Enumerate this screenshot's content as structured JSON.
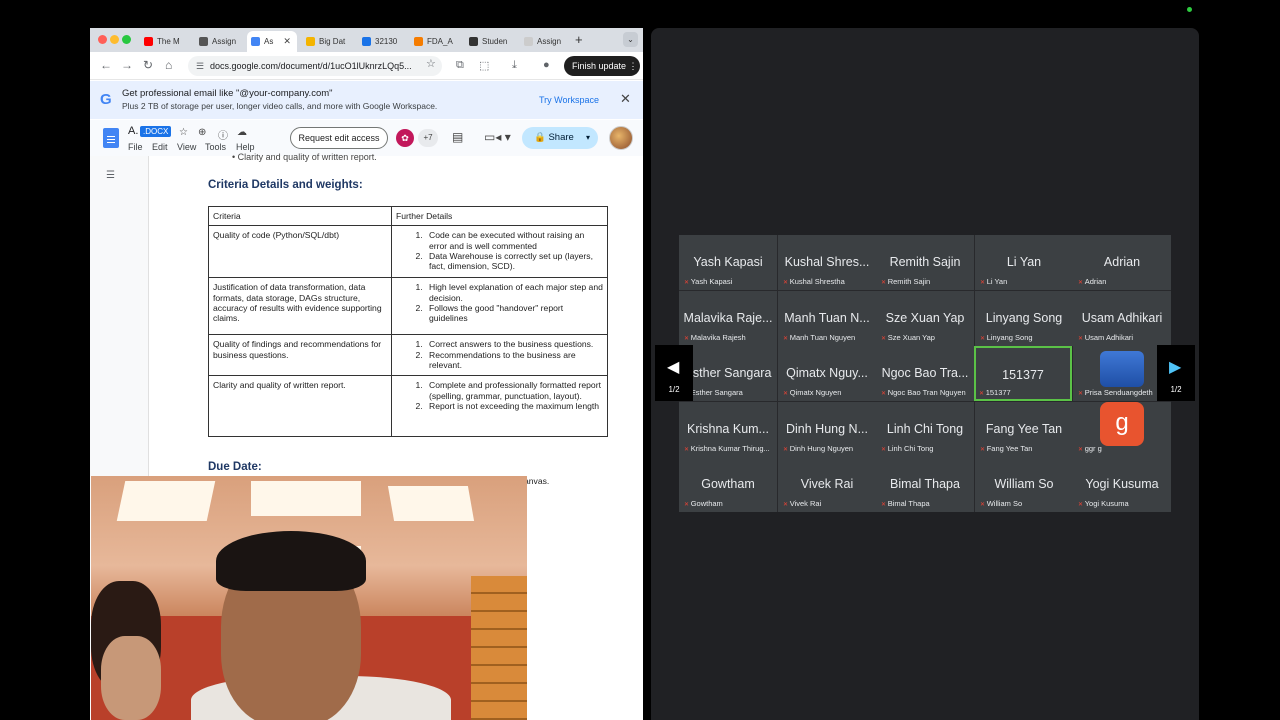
{
  "browser": {
    "tabs": [
      {
        "label": "The M",
        "color": "#ff0000"
      },
      {
        "label": "Assign",
        "color": "#555555"
      },
      {
        "label": "As",
        "color": "#4285f4"
      },
      {
        "label": "Big Dat",
        "color": "#f4b400"
      },
      {
        "label": "32130",
        "color": "#1a73e8"
      },
      {
        "label": "FDA_A",
        "color": "#f57c00"
      },
      {
        "label": "Studen",
        "color": "#333333"
      },
      {
        "label": "Assign",
        "color": "#cccccc"
      }
    ],
    "url": "docs.google.com/document/d/1ucO1lUknrzLQq5...",
    "finish_update": "Finish update"
  },
  "promo": {
    "line1": "Get professional email like \"@your-company.com\"",
    "line2": "Plus 2 TB of storage per user, longer video calls, and more with Google Workspace.",
    "try": "Try Workspace"
  },
  "docs": {
    "title": "A.",
    "badge": ".DOCX",
    "menu": [
      "File",
      "Edit",
      "View",
      "Tools",
      "Help"
    ],
    "request_edit": "Request edit access",
    "extra_users": "+7",
    "share": "Share"
  },
  "document": {
    "bullet_top": "Clarity and quality of written report.",
    "criteria_heading": "Criteria Details and weights:",
    "table_headers": [
      "Criteria",
      "Further Details"
    ],
    "rows": [
      {
        "criteria": "Quality of code (Python/SQL/dbt)",
        "details": [
          "Code can be executed without raising an error and is well commented",
          "Data Warehouse is correctly set up (layers, fact, dimension, SCD)."
        ]
      },
      {
        "criteria": "Justification of data transformation, data formats, data storage, DAGs structure, accuracy of results with evidence supporting claims.",
        "details": [
          "High level explanation of each major step and decision.",
          "Follows the good \"handover\" report guidelines"
        ]
      },
      {
        "criteria": "Quality of findings and recommendations for business questions.",
        "details": [
          "Correct answers to the business questions.",
          "Recommendations to the business are relevant."
        ]
      },
      {
        "criteria": "Clarity and quality of written report.",
        "details": [
          "Complete and professionally formatted report (spelling, grammar, punctuation, layout).",
          "Report is not exceeding the maximum length"
        ]
      }
    ],
    "due_heading": "Due Date:",
    "canvas_fragment": "anvas."
  },
  "meeting": {
    "page_label": "1/2",
    "participants": [
      {
        "name": "Yash Kapasi",
        "sub": "Yash Kapasi"
      },
      {
        "name": "Kushal Shres...",
        "sub": "Kushal Shrestha"
      },
      {
        "name": "Remith Sajin",
        "sub": "Remith Sajin"
      },
      {
        "name": "Li Yan",
        "sub": "Li Yan"
      },
      {
        "name": "Adrian",
        "sub": "Adrian"
      },
      {
        "name": "Malavika Raje...",
        "sub": "Malavika Rajesh"
      },
      {
        "name": "Manh Tuan N...",
        "sub": "Manh Tuan Nguyen"
      },
      {
        "name": "Sze Xuan Yap",
        "sub": "Sze Xuan Yap"
      },
      {
        "name": "Linyang Song",
        "sub": "Linyang Song"
      },
      {
        "name": "Usam Adhikari",
        "sub": "Usam Adhikari"
      },
      {
        "name": "Esther Sangara",
        "sub": "Esther Sangara"
      },
      {
        "name": "Qimatx Nguy...",
        "sub": "Qimatx Nguyen"
      },
      {
        "name": "Ngoc Bao Tra...",
        "sub": "Ngoc Bao Tran Nguyen"
      },
      {
        "name": "151377",
        "sub": "151377"
      },
      {
        "name": "",
        "sub": "Prisa Senduangdeth"
      },
      {
        "name": "Krishna Kum...",
        "sub": "Krishna Kumar Thirug..."
      },
      {
        "name": "Dinh Hung N...",
        "sub": "Dinh Hung Nguyen"
      },
      {
        "name": "Linh Chi Tong",
        "sub": "Linh Chi Tong"
      },
      {
        "name": "Fang Yee Tan",
        "sub": "Fang Yee Tan"
      },
      {
        "name": "g",
        "sub": "ggr g"
      },
      {
        "name": "Gowtham",
        "sub": "Gowtham"
      },
      {
        "name": "Vivek Rai",
        "sub": "Vivek Rai"
      },
      {
        "name": "Bimal Thapa",
        "sub": "Bimal Thapa"
      },
      {
        "name": "William So",
        "sub": "William So"
      },
      {
        "name": "Yogi Kusuma",
        "sub": "Yogi Kusuma"
      }
    ]
  }
}
